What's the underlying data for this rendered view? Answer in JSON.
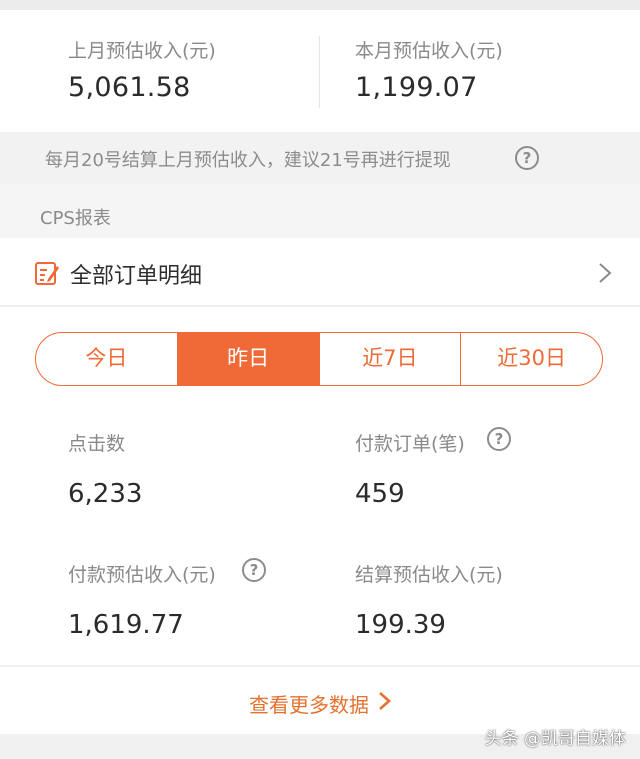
{
  "summary": {
    "last_month_label": "上月预估收入(元)",
    "last_month_value": "5,061.58",
    "this_month_label": "本月预估收入(元)",
    "this_month_value": "1,199.07"
  },
  "notice": {
    "text": "每月20号结算上月预估收入，建议21号再进行提现",
    "help_glyph": "?"
  },
  "section": {
    "title": "CPS报表"
  },
  "orders": {
    "label": "全部订单明细",
    "icon": "edit-list-icon"
  },
  "tabs": [
    {
      "label": "今日",
      "active": false
    },
    {
      "label": "昨日",
      "active": true
    },
    {
      "label": "近7日",
      "active": false
    },
    {
      "label": "近30日",
      "active": false
    }
  ],
  "stats": {
    "clicks_label": "点击数",
    "clicks_value": "6,233",
    "orders_label": "付款订单(笔)",
    "orders_value": "459",
    "paid_income_label": "付款预估收入(元)",
    "paid_income_value": "1,619.77",
    "settled_income_label": "结算预估收入(元)",
    "settled_income_value": "199.39"
  },
  "more": {
    "label": "查看更多数据"
  },
  "watermark": "头条 @凯哥自媒体",
  "colors": {
    "accent": "#ef6a36",
    "link": "#e5712f"
  }
}
